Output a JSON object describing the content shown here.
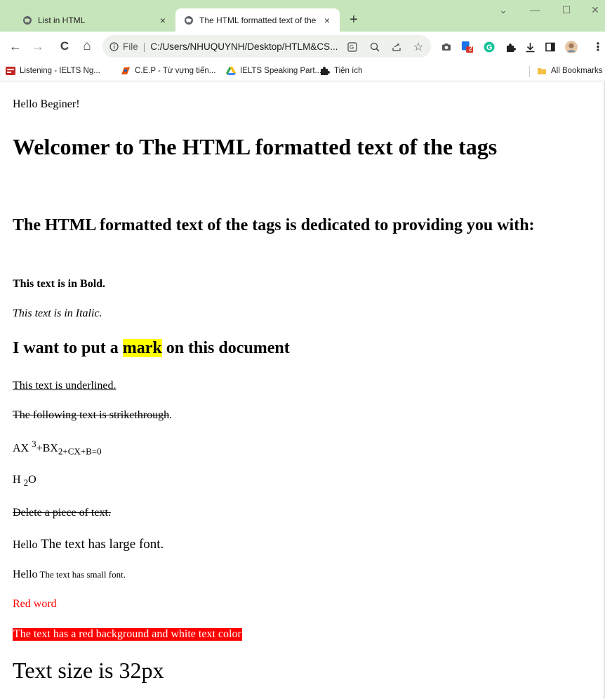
{
  "browser": {
    "tabs": [
      {
        "title": "List in HTML",
        "active": false,
        "close": "×"
      },
      {
        "title": "The HTML formatted text of the",
        "active": true,
        "close": "×"
      }
    ],
    "new_tab": "+",
    "window_controls": {
      "minimize": "—",
      "restore": "☐",
      "close": "✕",
      "tab_search": "⌄"
    }
  },
  "toolbar": {
    "back": "←",
    "forward": "→",
    "reload": "C",
    "home": "⌂",
    "omnibox": {
      "scheme_label": "File",
      "url": "C:/Users/NHUQUYNH/Desktop/HTLM&CS..."
    },
    "extension_badge": "2"
  },
  "bookmarks": {
    "items": [
      {
        "label": "Listening - IELTS Ng...",
        "icon": "ielts-favicon"
      },
      {
        "label": "C.E.P - Từ vựng tiến...",
        "icon": "cep-favicon"
      },
      {
        "label": "IELTS Speaking Part...",
        "icon": "drive-icon"
      },
      {
        "label": "Tiện ích",
        "icon": "puzzle-icon"
      }
    ],
    "all_bookmarks": "All Bookmarks"
  },
  "page": {
    "greeting": "Hello Beginer!",
    "h1": "Welcomer to The HTML formatted text of the tags",
    "h2": "The HTML formatted text of the tags is dedicated to providing you with:",
    "bold": "This text is in Bold.",
    "italic": "This text is in Italic.",
    "mark_heading": {
      "before": "I want to put a ",
      "mark": "mark",
      "after": " on this document"
    },
    "underlined": "This text is underlined.",
    "strike": {
      "struck": "The following text is strikethrough",
      "rest": "."
    },
    "equation": {
      "a": "AX ",
      "sup": "3",
      "b": "+BX",
      "sub": "2+CX+B=0"
    },
    "water": {
      "h": "H ",
      "sub": "2",
      "o": "O"
    },
    "deleted": "Delete a piece of text.",
    "large": {
      "hello": "Hello",
      "text": " The text has large font."
    },
    "small": {
      "hello": "Hello",
      "text": " The text has small font."
    },
    "red_word": "Red word",
    "red_bg": "The text has a red background and white text color",
    "size32": "Text size is 32px"
  },
  "colors": {
    "tabstrip": "#c6e5ba",
    "mark": "#ffff00",
    "red": "#ff0000"
  }
}
